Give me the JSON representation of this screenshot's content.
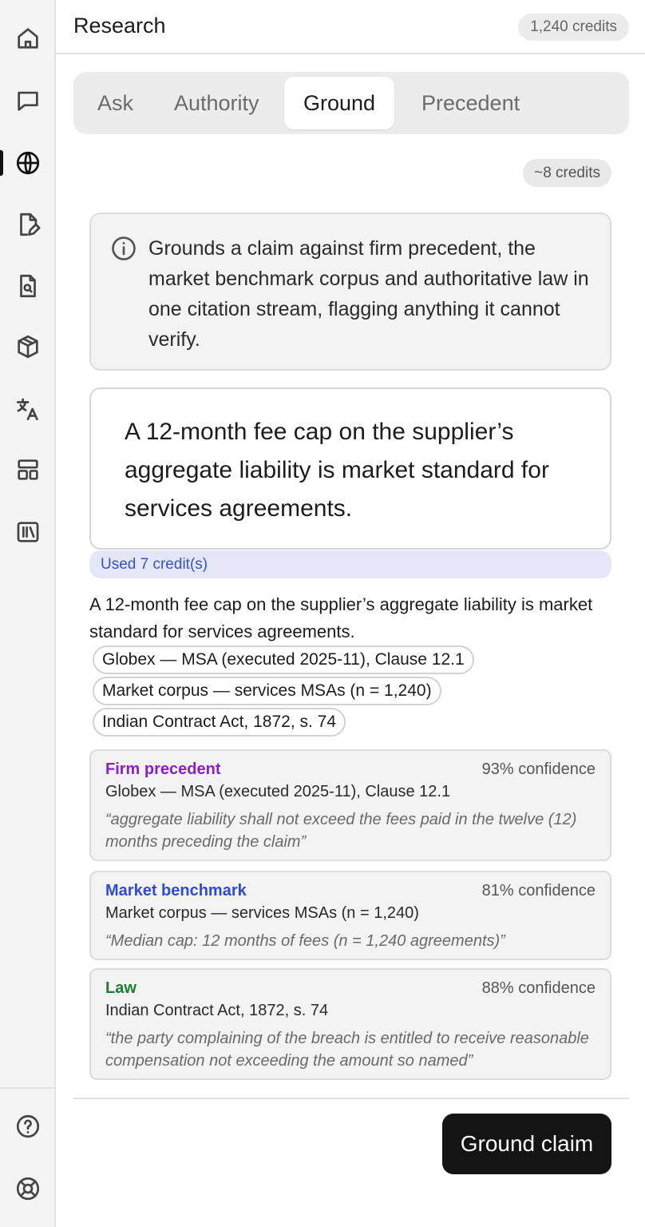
{
  "header": {
    "title": "Research",
    "credits": "1,240 credits"
  },
  "rail": {
    "items": [
      {
        "icon": "home-icon"
      },
      {
        "icon": "chat-icon"
      },
      {
        "icon": "globe-icon",
        "active": true
      },
      {
        "icon": "document-edit-icon"
      },
      {
        "icon": "document-search-icon"
      },
      {
        "icon": "cube-icon"
      },
      {
        "icon": "translate-icon"
      },
      {
        "icon": "layout-icon"
      },
      {
        "icon": "library-icon"
      }
    ],
    "bottom": [
      {
        "icon": "help-icon"
      },
      {
        "icon": "support-icon"
      }
    ]
  },
  "tabs": [
    {
      "label": "Ask"
    },
    {
      "label": "Authority"
    },
    {
      "label": "Ground",
      "active": true
    },
    {
      "label": "Precedent"
    }
  ],
  "cost_estimate": "~8 credits",
  "info": {
    "icon": "info-icon",
    "text": "Grounds a claim against firm precedent, the market benchmark corpus and authoritative law in one citation stream, flagging anything it cannot verify."
  },
  "claim_input": {
    "value": "A 12-month fee cap on the supplier’s aggregate liability is market standard for services agreements."
  },
  "used_credits": "Used 7 credit(s)",
  "result": {
    "text": "A 12-month fee cap on the supplier’s aggregate liability is market standard for services agreements.",
    "chips": [
      "Globex — MSA (executed 2025-11), Clause 12.1",
      "Market corpus — services MSAs (n = 1,240)",
      "Indian Contract Act, 1872, s. 74"
    ]
  },
  "sources": [
    {
      "label": "Firm precedent",
      "label_color": "#8a1fc9",
      "confidence": "93% confidence",
      "reference": "Globex — MSA (executed 2025-11), Clause 12.1",
      "quote": "“aggregate liability shall not exceed the fees paid in the twelve (12) months preceding the claim”"
    },
    {
      "label": "Market benchmark",
      "label_color": "#2f4bd1",
      "confidence": "81% confidence",
      "reference": "Market corpus — services MSAs (n = 1,240)",
      "quote": "“Median cap: 12 months of fees (n = 1,240 agreements)”"
    },
    {
      "label": "Law",
      "label_color": "#1e7d32",
      "confidence": "88% confidence",
      "reference": "Indian Contract Act, 1872, s. 74",
      "quote": "“the party complaining of the breach is entitled to receive reasonable compensation not exceeding the amount so named”"
    }
  ],
  "action": {
    "label": "Ground claim"
  }
}
